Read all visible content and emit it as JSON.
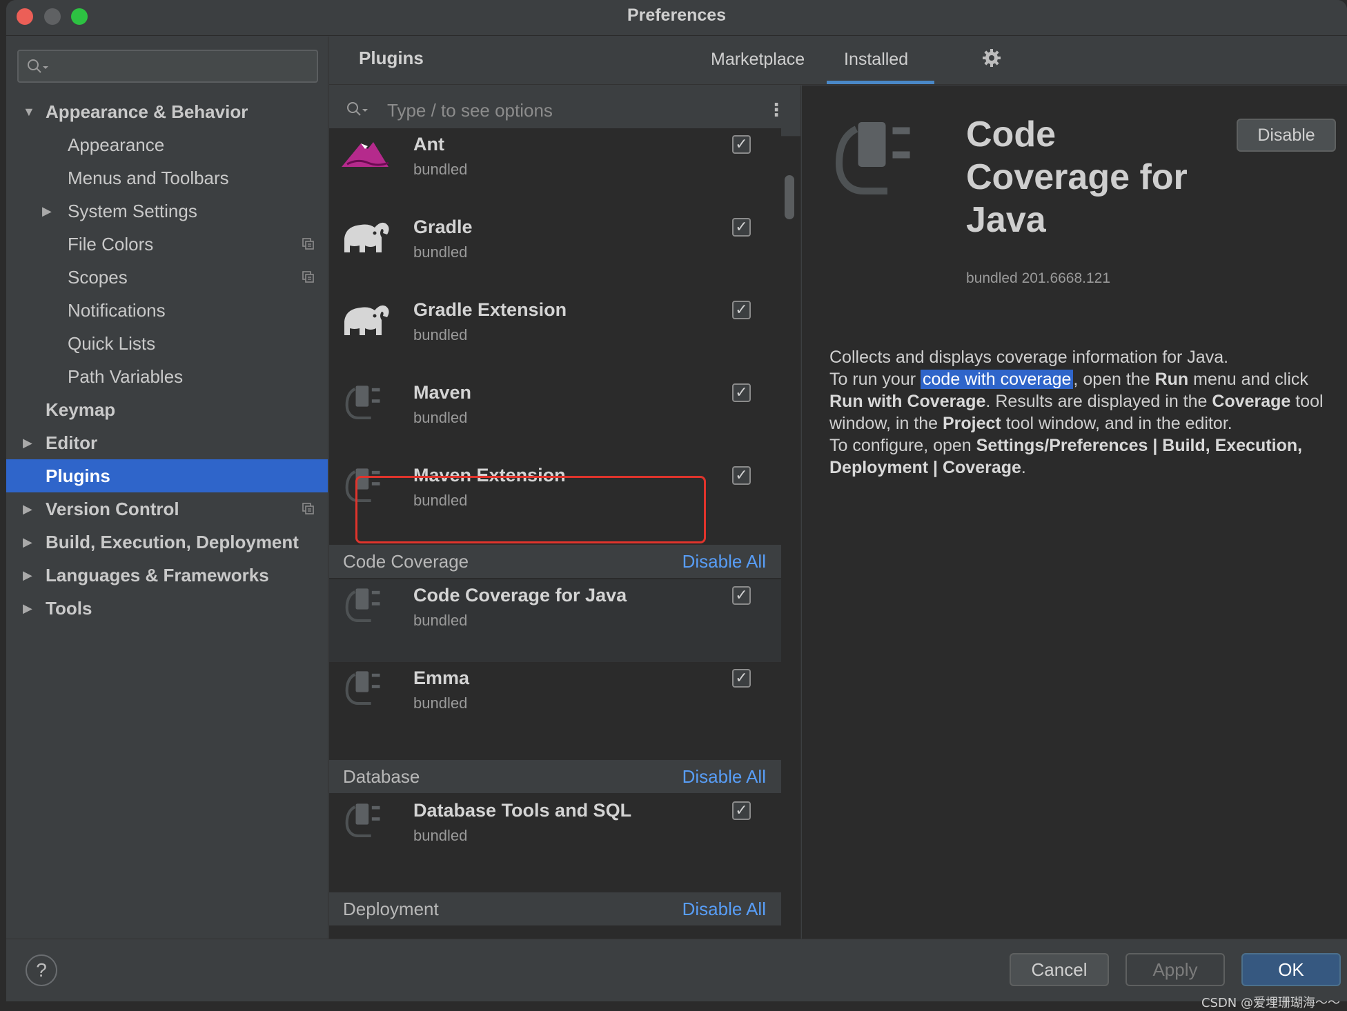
{
  "window": {
    "title": "Preferences"
  },
  "sidebar": {
    "search_value": "",
    "items": [
      {
        "label": "Appearance & Behavior",
        "level": 0,
        "expanded": true,
        "bold": true
      },
      {
        "label": "Appearance",
        "level": 1
      },
      {
        "label": "Menus and Toolbars",
        "level": 1
      },
      {
        "label": "System Settings",
        "level": 1,
        "collapsed": true
      },
      {
        "label": "File Colors",
        "level": 1,
        "copy_icon": true
      },
      {
        "label": "Scopes",
        "level": 1,
        "copy_icon": true
      },
      {
        "label": "Notifications",
        "level": 1
      },
      {
        "label": "Quick Lists",
        "level": 1
      },
      {
        "label": "Path Variables",
        "level": 1
      },
      {
        "label": "Keymap",
        "level": 0,
        "bold": true
      },
      {
        "label": "Editor",
        "level": 0,
        "collapsed": true,
        "bold": true
      },
      {
        "label": "Plugins",
        "level": 0,
        "selected": true,
        "bold": true
      },
      {
        "label": "Version Control",
        "level": 0,
        "collapsed": true,
        "copy_icon": true,
        "bold": true
      },
      {
        "label": "Build, Execution, Deployment",
        "level": 0,
        "collapsed": true,
        "bold": true
      },
      {
        "label": "Languages & Frameworks",
        "level": 0,
        "collapsed": true,
        "bold": true
      },
      {
        "label": "Tools",
        "level": 0,
        "collapsed": true,
        "bold": true
      }
    ]
  },
  "header": {
    "title": "Plugins",
    "tabs": [
      {
        "label": "Marketplace",
        "active": false
      },
      {
        "label": "Installed",
        "active": true
      }
    ],
    "settings_icon": "gear-icon"
  },
  "plugin_list": {
    "search_placeholder": "Type / to see options",
    "plugins_top": [
      {
        "name": "Ant",
        "sub": "bundled",
        "checked": true,
        "icon": "ant-icon"
      },
      {
        "name": "Gradle",
        "sub": "bundled",
        "checked": true,
        "icon": "elephant-icon"
      },
      {
        "name": "Gradle Extension",
        "sub": "bundled",
        "checked": true,
        "icon": "elephant-icon"
      },
      {
        "name": "Maven",
        "sub": "bundled",
        "checked": true,
        "icon": "plug-icon"
      },
      {
        "name": "Maven Extension",
        "sub": "bundled",
        "checked": true,
        "icon": "plug-icon"
      }
    ],
    "groups": [
      {
        "name": "Code Coverage",
        "action": "Disable All",
        "plugins": [
          {
            "name": "Code Coverage for Java",
            "sub": "bundled",
            "checked": true,
            "selected": true,
            "icon": "plug-icon"
          },
          {
            "name": "Emma",
            "sub": "bundled",
            "checked": true,
            "icon": "plug-icon"
          }
        ]
      },
      {
        "name": "Database",
        "action": "Disable All",
        "plugins": [
          {
            "name": "Database Tools and SQL",
            "sub": "bundled",
            "checked": true,
            "icon": "plug-icon"
          }
        ]
      },
      {
        "name": "Deployment",
        "action": "Disable All",
        "plugins": []
      }
    ]
  },
  "detail": {
    "title": "Code Coverage for Java",
    "version": "bundled 201.6668.121",
    "disable_label": "Disable",
    "desc": {
      "p1": "Collects and displays coverage information for Java.",
      "p2a": "To run your ",
      "p2_link": "code with coverage",
      "p2b": ", open the ",
      "p2_run": "Run",
      "p2c": " menu and click ",
      "p2_rwc": "Run with Coverage",
      "p2d": ". Results are displayed in the ",
      "p2_cov": "Coverage",
      "p2e": " tool window, in the ",
      "p2_proj": "Project",
      "p2f": " tool window, and in the editor.",
      "p3a": "To configure, open ",
      "p3_path": "Settings/Preferences | Build, Execution, Deployment | Coverage",
      "p3b": "."
    }
  },
  "footer": {
    "help_label": "?",
    "cancel_label": "Cancel",
    "apply_label": "Apply",
    "ok_label": "OK",
    "watermark": "CSDN @爱埋珊瑚海～～"
  },
  "colors": {
    "accent": "#2f65ca",
    "link": "#589df6",
    "highlight_box": "#e0342c"
  }
}
